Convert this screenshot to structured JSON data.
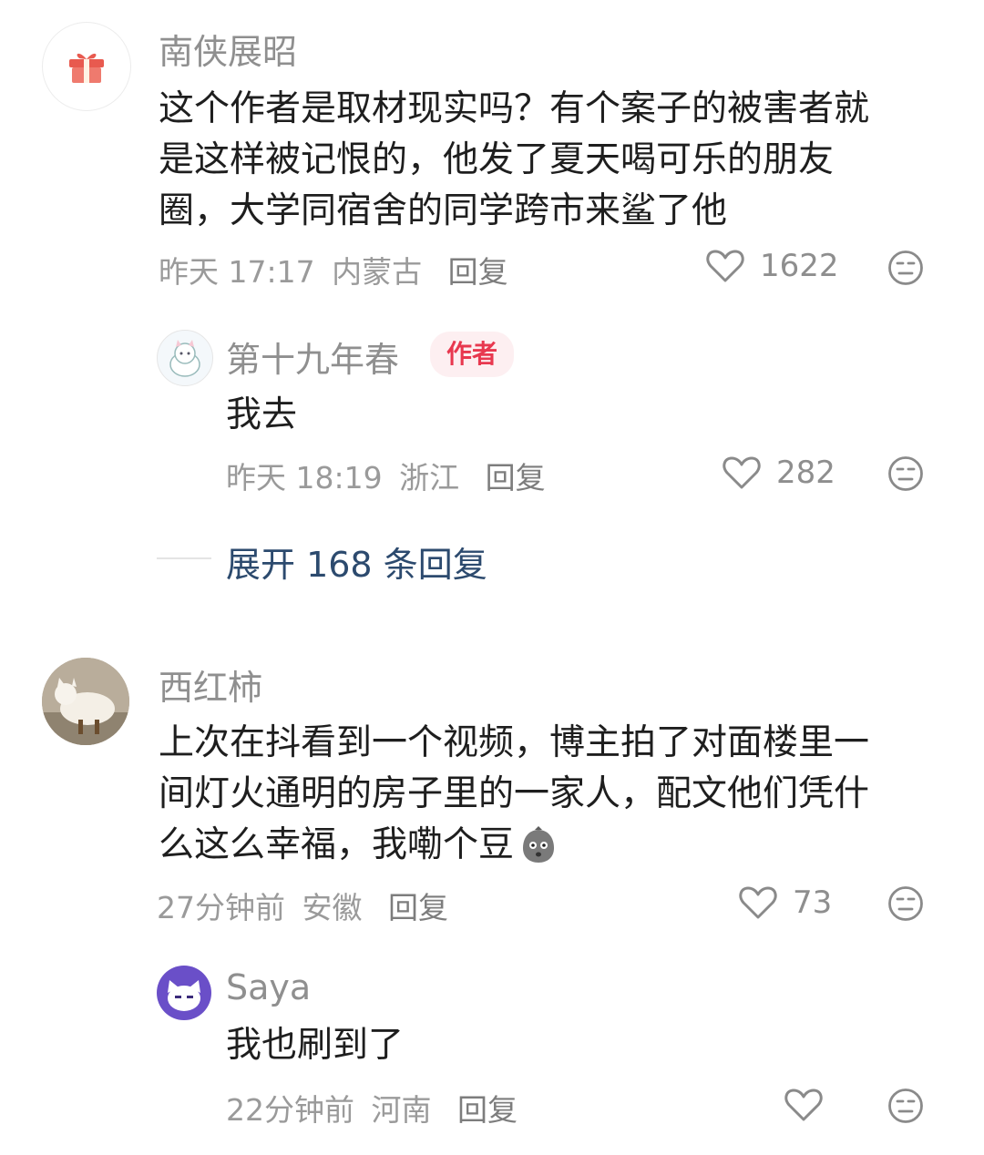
{
  "comments": [
    {
      "username": "南侠展昭",
      "lines": [
        "这个作者是取材现实吗？有个案子的被害者就",
        "是这样被记恨的，他发了夏天喝可乐的朋友",
        "圈，大学同宿舍的同学跨市来鲨了他"
      ],
      "time": "昨天 17:17",
      "location": "内蒙古",
      "reply_label": "回复",
      "likes": "1622",
      "reply": {
        "username": "第十九年春",
        "badge": "作者",
        "text": "我去",
        "time": "昨天 18:19",
        "location": "浙江",
        "reply_label": "回复",
        "likes": "282"
      },
      "expand_label": "展开 168 条回复"
    },
    {
      "username": "西红柿",
      "lines": [
        "上次在抖看到一个视频，博主拍了对面楼里一",
        "间灯火通明的房子里的一家人，配文他们凭什",
        "么这么幸福，我嘞个豆"
      ],
      "time": "27分钟前",
      "location": "安徽",
      "reply_label": "回复",
      "likes": "73",
      "reply": {
        "username": "Saya",
        "text": "我也刷到了",
        "time": "22分钟前",
        "location": "河南",
        "reply_label": "回复",
        "likes": ""
      }
    }
  ],
  "colors": {
    "badge_text": "#e8384f",
    "badge_bg": "#fdeff1",
    "expand_text": "#2c4a6e"
  },
  "icons": [
    "gift-icon",
    "heart-icon",
    "meh-face-icon",
    "cat-avatar",
    "bean-emoji-icon"
  ]
}
